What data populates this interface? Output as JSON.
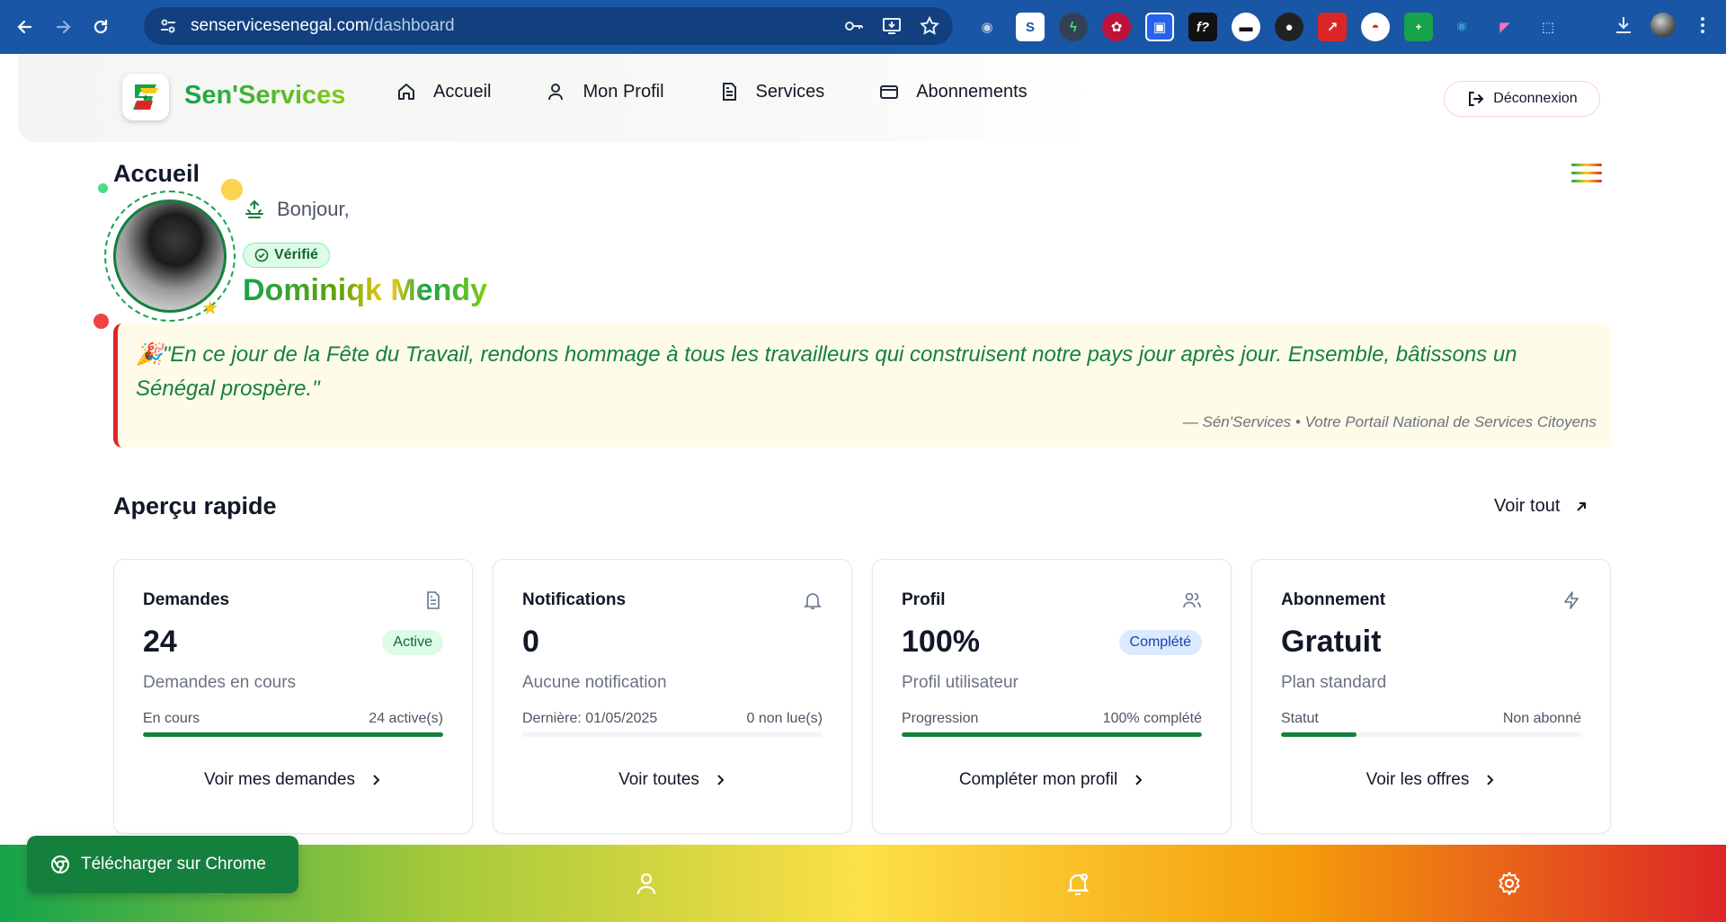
{
  "browser": {
    "url_host": "senservicesenegal.com",
    "url_path": "/dashboard"
  },
  "header": {
    "brand": "Sen'Services",
    "nav": [
      {
        "label": "Accueil",
        "icon": "home-icon"
      },
      {
        "label": "Mon Profil",
        "icon": "user-icon"
      },
      {
        "label": "Services",
        "icon": "file-icon"
      },
      {
        "label": "Abonnements",
        "icon": "card-icon"
      }
    ],
    "logout_label": "Déconnexion"
  },
  "page": {
    "title": "Accueil"
  },
  "profile": {
    "greeting": "Bonjour,",
    "verified_label": "Vérifié",
    "name": "Dominiqk Mendy"
  },
  "quote": {
    "emoji": "🎉",
    "text": "\"En ce jour de la Fête du Travail, rendons hommage à tous les travailleurs qui construisent notre pays jour après jour. Ensemble, bâtissons un Sénégal prospère.\"",
    "signature": "— Sén'Services • Votre Portail National de Services Citoyens"
  },
  "overview": {
    "title": "Aperçu rapide",
    "see_all": "Voir tout",
    "cards": [
      {
        "title": "Demandes",
        "icon": "document-icon",
        "value": "24",
        "badge": "Active",
        "subtitle": "Demandes en cours",
        "meta_left": "En cours",
        "meta_right": "24 active(s)",
        "progress": 1.0,
        "action": "Voir mes demandes"
      },
      {
        "title": "Notifications",
        "icon": "bell-icon",
        "value": "0",
        "badge": "",
        "subtitle": "Aucune notification",
        "meta_left": "Dernière: 01/05/2025",
        "meta_right": "0 non lue(s)",
        "progress": 0.0,
        "action": "Voir toutes"
      },
      {
        "title": "Profil",
        "icon": "users-icon",
        "value": "100%",
        "badge": "Complété",
        "subtitle": "Profil utilisateur",
        "meta_left": "Progression",
        "meta_right": "100% complété",
        "progress": 1.0,
        "action": "Compléter mon profil"
      },
      {
        "title": "Abonnement",
        "icon": "bolt-icon",
        "value": "Gratuit",
        "badge": "",
        "subtitle": "Plan standard",
        "meta_left": "Statut",
        "meta_right": "Non abonné",
        "progress": 0.25,
        "action": "Voir les offres"
      }
    ]
  },
  "install_button": {
    "label": "Télécharger sur Chrome"
  },
  "colors": {
    "brand_green": "#15803d",
    "flag_yellow": "#fde047",
    "flag_red": "#dc2626",
    "browser_blue": "#1a56a6"
  }
}
